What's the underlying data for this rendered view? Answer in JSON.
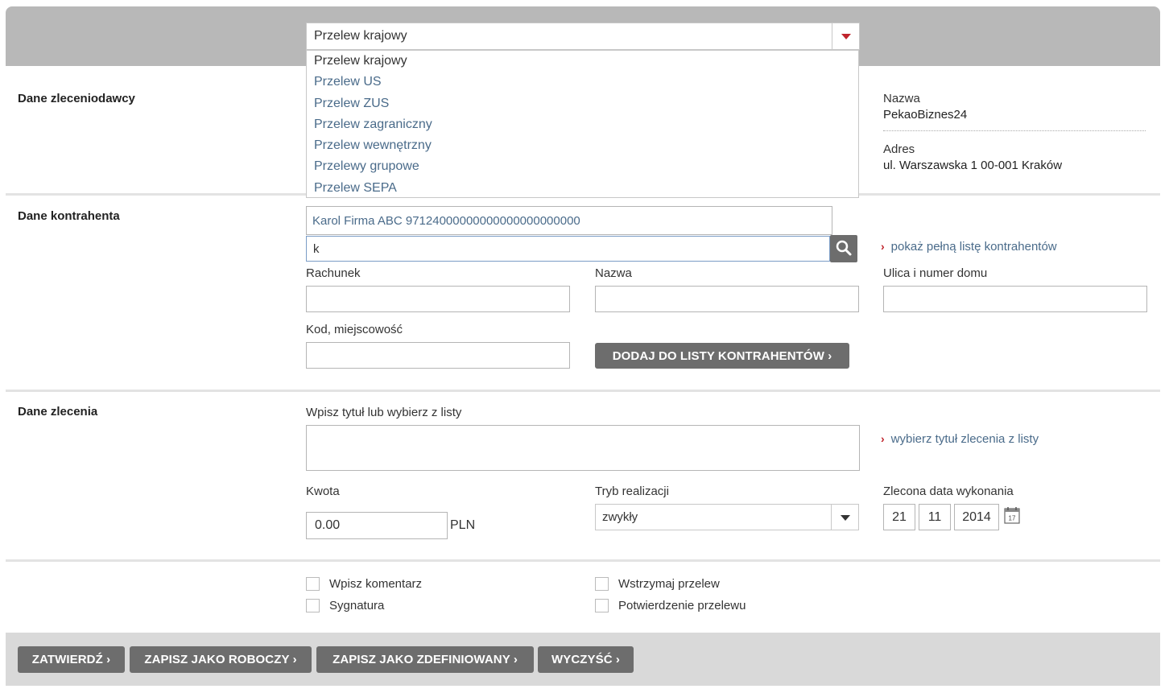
{
  "transfer_type": {
    "selected": "Przelew krajowy",
    "options": [
      "Przelew krajowy",
      "Przelew US",
      "Przelew ZUS",
      "Przelew zagraniczny",
      "Przelew wewnętrzny",
      "Przelewy grupowe",
      "Przelew SEPA"
    ]
  },
  "ordering_party": {
    "section_title": "Dane zleceniodawcy",
    "name_label": "Nazwa",
    "name_value": "PekaoBiznes24",
    "address_label": "Adres",
    "address_value": "ul. Warszawska 1 00-001 Kraków"
  },
  "counterparty": {
    "section_title": "Dane kontrahenta",
    "suggestion": "Karol Firma ABC 97124000000000000000000000",
    "search_value": "k",
    "show_list_link": "pokaż pełną listę kontrahentów",
    "account_label": "Rachunek",
    "name_label": "Nazwa",
    "street_label": "Ulica i numer domu",
    "city_label": "Kod, miejscowość",
    "add_button": "DODAJ DO LISTY KONTRAHENTÓW ›"
  },
  "order": {
    "section_title": "Dane zlecenia",
    "title_label": "Wpisz tytuł lub wybierz z listy",
    "choose_title_link": "wybierz tytuł zlecenia z listy",
    "amount_label": "Kwota",
    "amount_value": "0.00",
    "currency": "PLN",
    "mode_label": "Tryb realizacji",
    "mode_value": "zwykły",
    "date_label": "Zlecona data wykonania",
    "date_day": "21",
    "date_month": "11",
    "date_year": "2014",
    "calendar_day": "17"
  },
  "options": {
    "comment": "Wpisz komentarz",
    "signature": "Sygnatura",
    "hold": "Wstrzymaj przelew",
    "confirmation": "Potwierdzenie przelewu"
  },
  "footer_buttons": {
    "confirm": "ZATWIERDŹ ›",
    "save_draft": "ZAPISZ JAKO ROBOCZY ›",
    "save_defined": "ZAPISZ JAKO ZDEFINIOWANY ›",
    "clear": "WYCZYŚĆ ›"
  },
  "colors": {
    "accent": "#c0242c",
    "link": "#4a6b8a",
    "button": "#6d6d6d",
    "header": "#b8b8b8"
  }
}
